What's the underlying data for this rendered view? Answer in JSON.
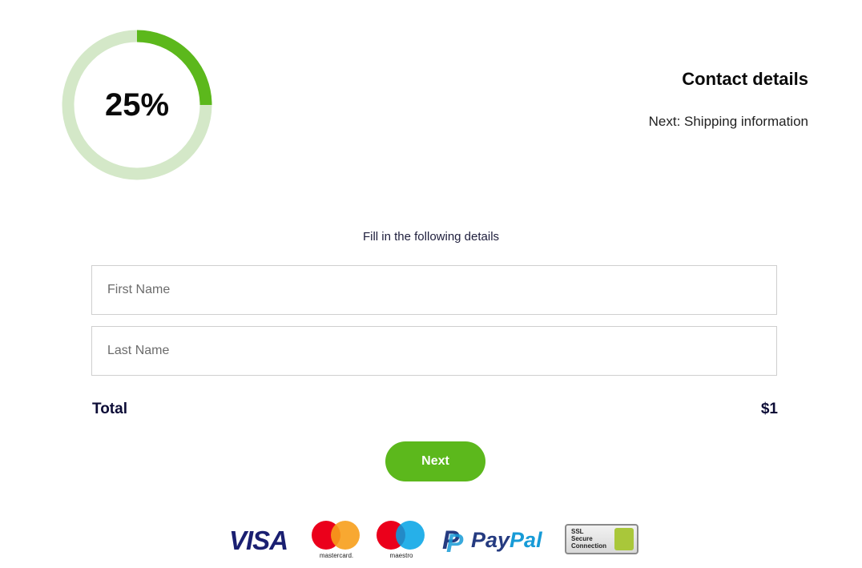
{
  "progress": {
    "percent_label": "25%",
    "fraction": 0.25,
    "color": "#5cb81c",
    "track_color": "#d4e8c8"
  },
  "step": {
    "title": "Contact details",
    "next": "Next: Shipping information"
  },
  "form": {
    "intro": "Fill in the following details",
    "first_name": {
      "placeholder": "First Name",
      "value": ""
    },
    "last_name": {
      "placeholder": "Last Name",
      "value": ""
    }
  },
  "total": {
    "label": "Total",
    "amount": "$1"
  },
  "next_button": {
    "label": "Next",
    "color": "#5cb81c"
  },
  "payment_logos": {
    "visa": "VISA",
    "mastercard": "mastercard.",
    "maestro": "maestro",
    "paypal": {
      "pay": "Pay",
      "pal": "Pal"
    },
    "ssl": [
      "SSL",
      "Secure",
      "Connection"
    ]
  }
}
